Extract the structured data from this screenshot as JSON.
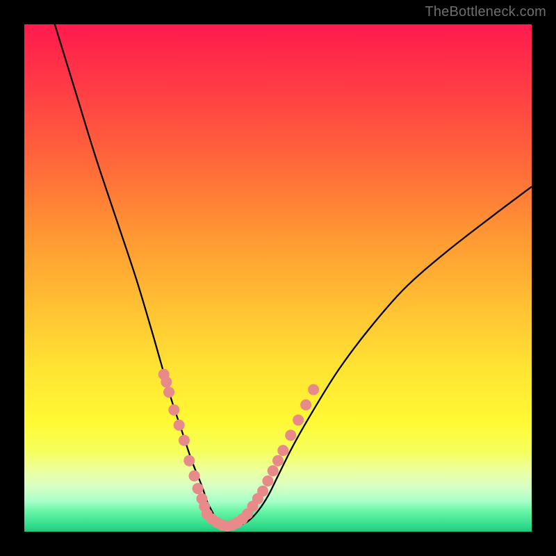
{
  "watermark": {
    "text": "TheBottleneck.com"
  },
  "chart_data": {
    "type": "line",
    "title": "",
    "xlabel": "",
    "ylabel": "",
    "xlim": [
      0,
      100
    ],
    "ylim": [
      0,
      100
    ],
    "gradient_stops": [
      {
        "offset": 0,
        "color": "#ff1a4d"
      },
      {
        "offset": 12,
        "color": "#ff3b46"
      },
      {
        "offset": 28,
        "color": "#ff6a3a"
      },
      {
        "offset": 42,
        "color": "#ff9933"
      },
      {
        "offset": 56,
        "color": "#ffc233"
      },
      {
        "offset": 68,
        "color": "#ffe433"
      },
      {
        "offset": 78,
        "color": "#fff933"
      },
      {
        "offset": 84,
        "color": "#f6ff5a"
      },
      {
        "offset": 88,
        "color": "#ecffa0"
      },
      {
        "offset": 91,
        "color": "#d9ffc4"
      },
      {
        "offset": 94,
        "color": "#a8ffc9"
      },
      {
        "offset": 96,
        "color": "#66f5a6"
      },
      {
        "offset": 99,
        "color": "#2fd98a"
      },
      {
        "offset": 100,
        "color": "#1fc87c"
      }
    ],
    "series": [
      {
        "name": "bottleneck-curve",
        "color": "#000000",
        "x": [
          6,
          10,
          14,
          18,
          22,
          25,
          27,
          29,
          31,
          33,
          35,
          36,
          37,
          38,
          39,
          40,
          42,
          44,
          46,
          48,
          50,
          53,
          57,
          62,
          68,
          75,
          83,
          92,
          100
        ],
        "y": [
          100,
          87,
          74,
          62,
          50,
          40,
          33,
          26,
          20,
          14,
          9,
          6,
          4,
          2,
          1.2,
          1,
          1.2,
          2,
          4,
          7,
          11,
          17,
          24,
          32,
          40,
          48,
          55,
          62,
          68
        ]
      }
    ],
    "dotted_highlight": {
      "color": "#e88a8a",
      "radius": 1.1,
      "left_segment": {
        "x": [
          27.5,
          28,
          28.5,
          29.5,
          30.5,
          31.5,
          32.5,
          33.5,
          34.2,
          35,
          35.5
        ],
        "y": [
          31,
          29.5,
          27.5,
          24,
          21,
          18,
          14,
          11,
          8.5,
          6.5,
          5
        ]
      },
      "right_segment": {
        "x": [
          45,
          46,
          47,
          48,
          49,
          50,
          51,
          52.5,
          54,
          55.5,
          57
        ],
        "y": [
          5,
          6.5,
          8,
          10,
          12,
          14,
          16,
          19,
          22,
          25,
          28
        ]
      },
      "bottom_segment": {
        "x": [
          36,
          37,
          38,
          39,
          40,
          41,
          42,
          43,
          44
        ],
        "y": [
          3.5,
          2.5,
          1.8,
          1.3,
          1.1,
          1.3,
          1.8,
          2.5,
          3.5
        ]
      }
    }
  }
}
